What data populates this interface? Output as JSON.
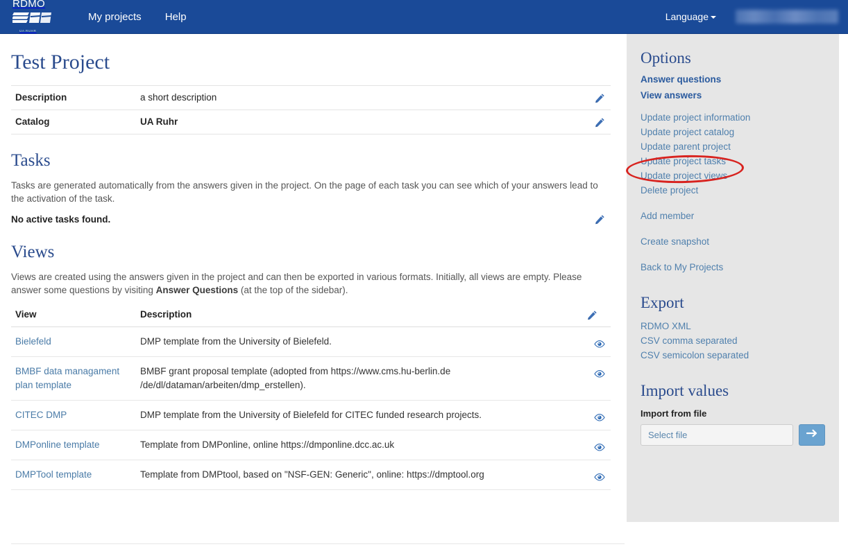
{
  "navbar": {
    "brand_text": "RDMO",
    "brand_sub": "UA RUHR",
    "links": [
      {
        "label": "My projects"
      },
      {
        "label": "Help"
      }
    ],
    "language_label": "Language",
    "user_label": ""
  },
  "main": {
    "page_title": "Test Project",
    "info_rows": [
      {
        "key": "Description",
        "value": "a short description",
        "bold": false
      },
      {
        "key": "Catalog",
        "value": "UA Ruhr",
        "bold": true
      }
    ],
    "tasks": {
      "heading": "Tasks",
      "description": "Tasks are generated automatically from the answers given in the project. On the page of each task you can see which of your answers lead to the activation of the task.",
      "empty_text": "No active tasks found."
    },
    "views": {
      "heading": "Views",
      "description_part1": "Views are created using the answers given in the project and can then be exported in various formats. Initially, all views are empty. Please answer some questions by visiting ",
      "description_bold": "Answer Questions",
      "description_part2": " (at the top of the sidebar).",
      "columns": {
        "view": "View",
        "description": "Description"
      },
      "rows": [
        {
          "name": "Bielefeld",
          "description": "DMP template from the University of Bielefeld."
        },
        {
          "name": "BMBF data managament plan template",
          "description": "BMBF grant proposal template (adopted from https://www.cms.hu-berlin.de /de/dl/dataman/arbeiten/dmp_erstellen)."
        },
        {
          "name": "CITEC DMP",
          "description": "DMP template from the University of Bielefeld for CITEC funded research projects."
        },
        {
          "name": "DMPonline template",
          "description": "Template from DMPonline, online https://dmponline.dcc.ac.uk"
        },
        {
          "name": "DMPTool template",
          "description": "Template from DMPtool, based on \"NSF-GEN: Generic\", online: https://dmptool.org"
        }
      ]
    }
  },
  "sidebar": {
    "options_heading": "Options",
    "primary_links": [
      {
        "label": "Answer questions"
      },
      {
        "label": "View answers"
      }
    ],
    "update_links": [
      {
        "label": "Update project information"
      },
      {
        "label": "Update project catalog"
      },
      {
        "label": "Update parent project"
      },
      {
        "label": "Update project tasks"
      },
      {
        "label": "Update project views"
      },
      {
        "label": "Delete project"
      }
    ],
    "action_links": [
      {
        "label": "Add member"
      },
      {
        "label": "Create snapshot"
      },
      {
        "label": "Back to My Projects"
      }
    ],
    "export_heading": "Export",
    "export_links": [
      {
        "label": "RDMO XML"
      },
      {
        "label": "CSV comma separated"
      },
      {
        "label": "CSV semicolon separated"
      }
    ],
    "import_heading": "Import values",
    "import_sub": "Import from file",
    "file_placeholder": "Select file"
  },
  "annotation": {
    "shape": "ellipse",
    "color": "#d8231f",
    "target": "Answer questions"
  },
  "colors": {
    "navbar_bg": "#1a4a98",
    "sidebar_bg": "#e6e6e6",
    "heading": "#2a4b8d",
    "link": "#4a7ba7",
    "sidebar_link": "#5080ad",
    "annotation_red": "#d8231f",
    "go_button": "#6aa3d0"
  }
}
